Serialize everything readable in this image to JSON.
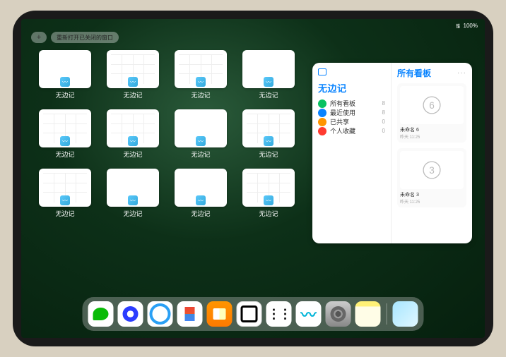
{
  "status": {
    "time": "",
    "wifi": "᯾",
    "battery": "100%"
  },
  "top": {
    "plus": "+",
    "reopen": "重新打开已关闭的窗口"
  },
  "tiles": [
    {
      "label": "无边记",
      "style": "blank"
    },
    {
      "label": "无边记",
      "style": "grid"
    },
    {
      "label": "无边记",
      "style": "grid"
    },
    {
      "label": "无边记",
      "style": "blank"
    },
    {
      "label": "无边记",
      "style": "grid"
    },
    {
      "label": "无边记",
      "style": "grid"
    },
    {
      "label": "无边记",
      "style": "blank"
    },
    {
      "label": "无边记",
      "style": "grid"
    },
    {
      "label": "无边记",
      "style": "grid"
    },
    {
      "label": "无边记",
      "style": "blank"
    },
    {
      "label": "无边记",
      "style": "blank"
    },
    {
      "label": "无边记",
      "style": "grid"
    }
  ],
  "panel": {
    "title": "无边记",
    "right_title": "所有看板",
    "more": "···",
    "items": [
      {
        "label": "所有看板",
        "count": 8,
        "color": "#07c160"
      },
      {
        "label": "最近使用",
        "count": 8,
        "color": "#0a84ff"
      },
      {
        "label": "已共享",
        "count": 0,
        "color": "#ff9500"
      },
      {
        "label": "个人收藏",
        "count": 0,
        "color": "#ff3b30"
      }
    ],
    "boards": [
      {
        "label": "未命名 6",
        "sub": "昨天 11:25",
        "digit": "6"
      },
      {
        "label": "未命名 3",
        "sub": "昨天 11:25",
        "digit": "3"
      }
    ]
  },
  "dock": {
    "apps": [
      {
        "name": "wechat"
      },
      {
        "name": "quark"
      },
      {
        "name": "qqbrowser"
      },
      {
        "name": "play"
      },
      {
        "name": "books"
      },
      {
        "name": "obsidian"
      },
      {
        "name": "altapp"
      },
      {
        "name": "freeform"
      },
      {
        "name": "settings"
      },
      {
        "name": "notes"
      }
    ],
    "recent": [
      {
        "name": "folder"
      }
    ]
  }
}
